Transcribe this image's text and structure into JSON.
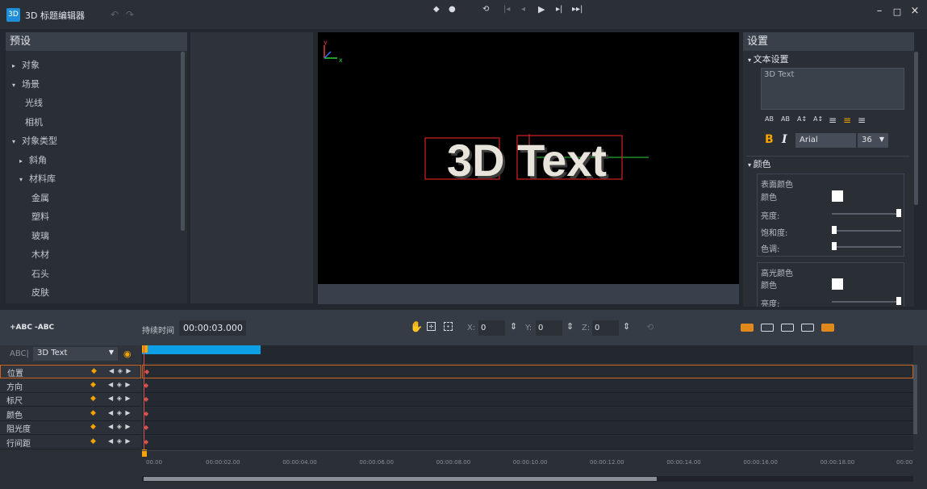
{
  "app": {
    "icon_text": "3D",
    "title": "3D 标题编辑器"
  },
  "presets": {
    "header": "预设",
    "items": [
      {
        "label": "对象",
        "arrow": "▸",
        "indent": 0
      },
      {
        "label": "场景",
        "arrow": "▾",
        "indent": 0
      },
      {
        "label": "光线",
        "arrow": "",
        "indent": 1
      },
      {
        "label": "相机",
        "arrow": "",
        "indent": 1
      },
      {
        "label": "对象类型",
        "arrow": "▾",
        "indent": 0
      },
      {
        "label": "斜角",
        "arrow": "▸",
        "indent": 1
      },
      {
        "label": "材料库",
        "arrow": "▾",
        "indent": 1
      },
      {
        "label": "金属",
        "arrow": "",
        "indent": 2
      },
      {
        "label": "塑料",
        "arrow": "",
        "indent": 2
      },
      {
        "label": "玻璃",
        "arrow": "",
        "indent": 2
      },
      {
        "label": "木材",
        "arrow": "",
        "indent": 2
      },
      {
        "label": "石头",
        "arrow": "",
        "indent": 2
      },
      {
        "label": "皮肤",
        "arrow": "",
        "indent": 2
      }
    ]
  },
  "viewport": {
    "text": "3D Text",
    "axis_y": "y",
    "axis_x": "x",
    "controls": [
      "◆",
      "●",
      "⟲",
      "|◂",
      "◂",
      "▶",
      "▸|",
      "▸▸|"
    ]
  },
  "settings": {
    "header": "设置",
    "text_section": "文本设置",
    "text_value": "3D Text",
    "format_icons": [
      "AB",
      "AB",
      "A↕",
      "A↕",
      "≡",
      "≡",
      "≡"
    ],
    "bold": "B",
    "italic": "I",
    "font": "Arial",
    "size": "36",
    "color_section": "颜色",
    "surface_title": "表面颜色",
    "color_label": "颜色",
    "brightness_label": "亮度:",
    "saturation_label": "饱和度:",
    "hue_label": "色调:",
    "highlight_title": "高光颜色",
    "hl_color_label": "颜色",
    "hl_brightness_label": "亮度:",
    "sliders": {
      "brightness": 1.0,
      "saturation": 0.0,
      "hue": 0.0,
      "hl_brightness": 1.0
    }
  },
  "toolbar": {
    "add_abc": "+ABC",
    "remove_abc": "-ABC",
    "duration_label": "持续时间",
    "duration_value": "00:00:03.000",
    "x_label": "X:",
    "x_value": "0",
    "y_label": "Y:",
    "y_value": "0",
    "z_label": "Z:",
    "z_value": "0"
  },
  "tracks": {
    "abc_prefix": "ABC|",
    "object_select": "3D Text",
    "rows": [
      "位置",
      "方向",
      "标尺",
      "颜色",
      "阻光度",
      "行间距"
    ],
    "nav_glyph": "◀ ◈ ▶"
  },
  "ruler": {
    "labels": [
      "00.00",
      "00:00:02.00",
      "00:00:04.00",
      "00:00:06.00",
      "00:00:08.00",
      "00:00:10.00",
      "00:00:12.00",
      "00:00:14.00",
      "00:00:16.00",
      "00:00:18.00",
      "00:00"
    ]
  },
  "colors": {
    "accent": "#1e8fd8",
    "keyframe": "#f5a300",
    "clip": "#0ea0e6",
    "selection": "#c8641e"
  }
}
